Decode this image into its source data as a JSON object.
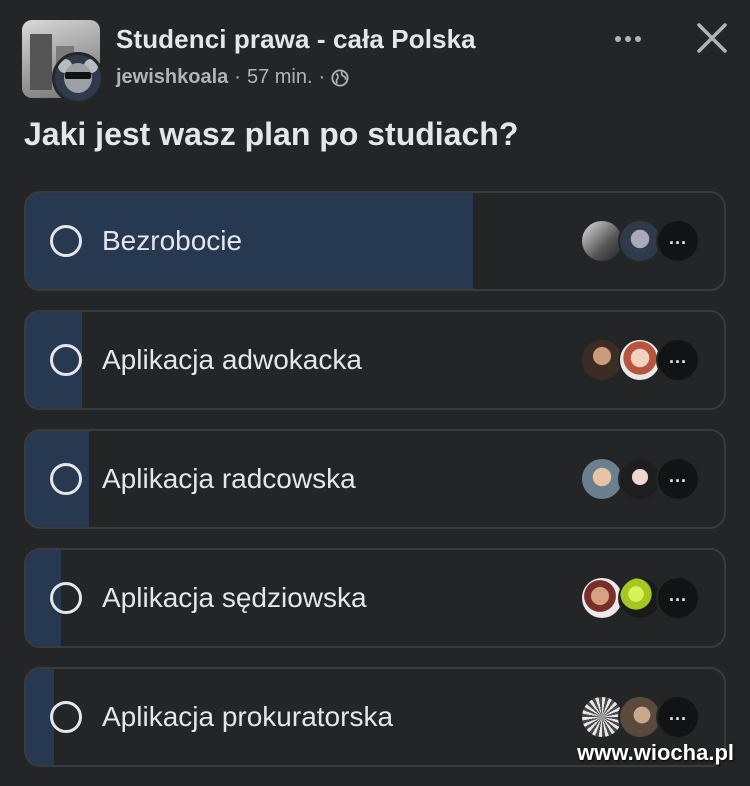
{
  "header": {
    "group_name": "Studenci prawa - cała Polska",
    "author": "jewishkoala",
    "time": "57 min.",
    "separator": "·",
    "privacy_icon": "globe-icon",
    "more_icon": "more-horizontal-icon",
    "close_icon": "close-icon"
  },
  "poll": {
    "question": "Jaki jest wasz plan po studiach?",
    "options": [
      {
        "label": "Bezrobocie",
        "fill_percent": 64
      },
      {
        "label": "Aplikacja adwokacka",
        "fill_percent": 8
      },
      {
        "label": "Aplikacja radcowska",
        "fill_percent": 9
      },
      {
        "label": "Aplikacja sędziowska",
        "fill_percent": 5
      },
      {
        "label": "Aplikacja prokuratorska",
        "fill_percent": 4
      }
    ]
  },
  "colors": {
    "background": "#242526",
    "fill": "#263951",
    "text": "#e4e6eb",
    "muted": "#b0b3b8",
    "border": "#3a3b3c"
  },
  "watermark": "www.wiocha.pl"
}
